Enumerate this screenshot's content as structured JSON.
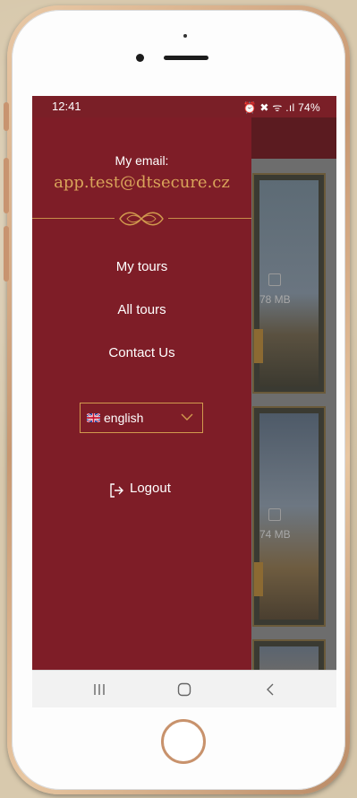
{
  "status_bar": {
    "time": "12:41",
    "icons_text": "⏰ ✖ ᯤ .ıl 74%",
    "battery": "74%"
  },
  "drawer": {
    "email_label": "My email:",
    "email_value": "app.test@dtsecure.cz",
    "menu": [
      "My tours",
      "All tours",
      "Contact Us"
    ],
    "language": {
      "selected": "english",
      "flag": "uk-flag-icon"
    },
    "logout_label": "Logout"
  },
  "background_tours": [
    {
      "size": "78 MB"
    },
    {
      "size": "74 MB"
    }
  ],
  "colors": {
    "drawer": "#7e1d27",
    "accent_gold": "#d9a45a",
    "phone_frame": "#c89872"
  },
  "nav_icons": [
    "recent-apps-icon",
    "home-icon",
    "back-icon"
  ]
}
